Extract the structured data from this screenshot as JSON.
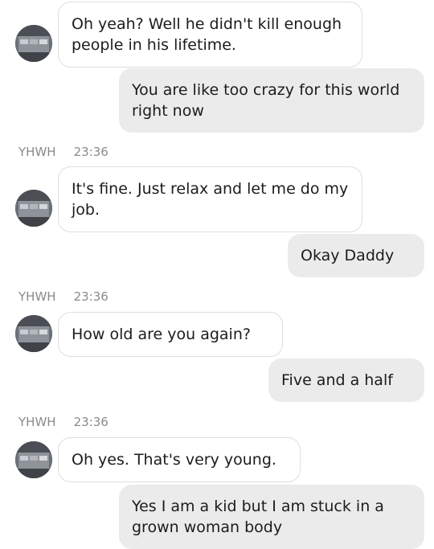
{
  "conversation": {
    "sender_name": "YHWH",
    "messages": [
      {
        "from": "them",
        "text": "Oh yeah? Well he didn't kill enough people in his lifetime."
      },
      {
        "from": "me",
        "text": "You are like too crazy for this world right now"
      },
      {
        "from": "them",
        "sender": "YHWH",
        "time": "23:36",
        "text": "It's fine. Just relax and let me do my job."
      },
      {
        "from": "me",
        "text": "Okay Daddy"
      },
      {
        "from": "them",
        "sender": "YHWH",
        "time": "23:36",
        "text": "How old are you again?"
      },
      {
        "from": "me",
        "text": "Five and a half"
      },
      {
        "from": "them",
        "sender": "YHWH",
        "time": "23:36",
        "text": "Oh yes. That's very young."
      },
      {
        "from": "me",
        "text": "Yes I am a kid but I am stuck in a grown woman body"
      }
    ]
  },
  "icons": {
    "avatar": "contact-avatar-photo"
  },
  "colors": {
    "incoming_bubble": "#ffffff",
    "incoming_border": "#dedede",
    "outgoing_bubble": "#ebebeb",
    "meta_text": "#8a8a8a",
    "text": "#1c1c1c"
  }
}
